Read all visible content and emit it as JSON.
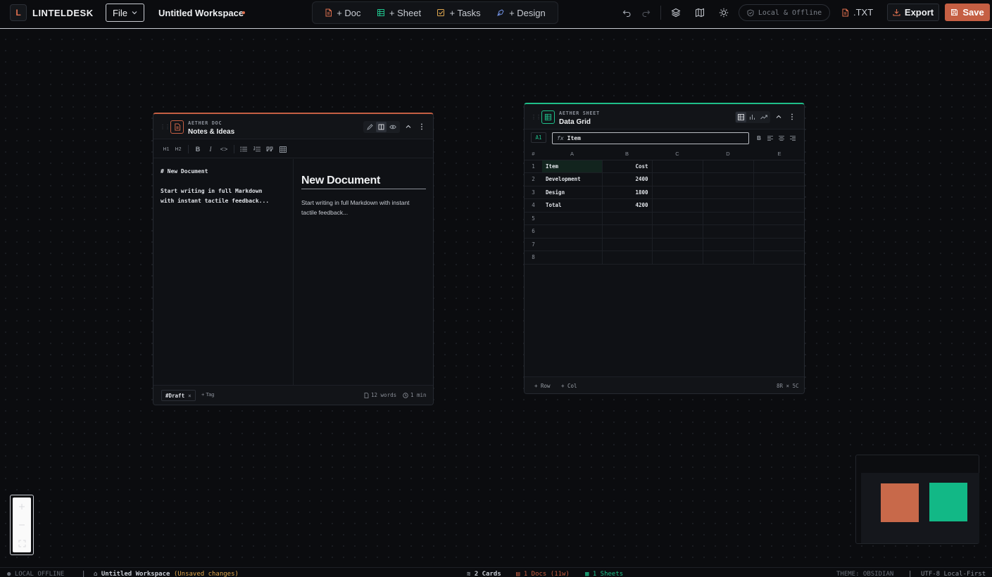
{
  "app": {
    "logo_letter": "L",
    "name": "LINTELDESK"
  },
  "menu": {
    "file_label": "File"
  },
  "workspace": {
    "title": "Untitled Workspace"
  },
  "add_actions": {
    "doc": "+ Doc",
    "sheet": "+ Sheet",
    "tasks": "+ Tasks",
    "design": "+ Design"
  },
  "status_pill": {
    "label": "Local & Offline"
  },
  "actions": {
    "txt": ".TXT",
    "export": "Export",
    "save": "Save"
  },
  "colors": {
    "accent": "#c55f43",
    "sheet_accent": "#1fbf8a"
  },
  "doc_card": {
    "kicker": "AETHER DOC",
    "title": "Notes & Ideas",
    "toolbar": [
      "H1",
      "H2",
      "B",
      "I",
      "<>"
    ],
    "source_heading": "# New Document",
    "source_body": "Start writing in full Markdown\nwith instant tactile feedback...",
    "preview_heading": "New Document",
    "preview_body": "Start writing in full Markdown with instant tactile feedback...",
    "tag": "#Draft",
    "add_tag": "+ Tag",
    "words": "12 words",
    "read_time": "1 min"
  },
  "sheet_card": {
    "kicker": "AETHER SHEET",
    "title": "Data Grid",
    "cell_ref": "A1",
    "fx_prefix": "fx",
    "fx_value": "Item",
    "columns": [
      "#",
      "A",
      "B",
      "C",
      "D",
      "E"
    ],
    "rows": [
      [
        "1",
        "Item",
        "Cost",
        "",
        "",
        ""
      ],
      [
        "2",
        "Development",
        "2400",
        "",
        "",
        ""
      ],
      [
        "3",
        "Design",
        "1800",
        "",
        "",
        ""
      ],
      [
        "4",
        "Total",
        "4200",
        "",
        "",
        ""
      ],
      [
        "5",
        "",
        "",
        "",
        "",
        ""
      ],
      [
        "6",
        "",
        "",
        "",
        "",
        ""
      ],
      [
        "7",
        "",
        "",
        "",
        "",
        ""
      ],
      [
        "8",
        "",
        "",
        "",
        "",
        ""
      ]
    ],
    "add_row": "+ Row",
    "add_col": "+ Col",
    "dims": "8R × 5C"
  },
  "statusbar": {
    "mode": "LOCAL OFFLINE",
    "workspace": "Untitled Workspace",
    "unsaved": "(Unsaved changes)",
    "cards": "2 Cards",
    "docs": "1 Docs (11w)",
    "sheets": "1 Sheets",
    "theme": "THEME: OBSIDIAN",
    "encoding": "UTF-8 Local-First"
  }
}
